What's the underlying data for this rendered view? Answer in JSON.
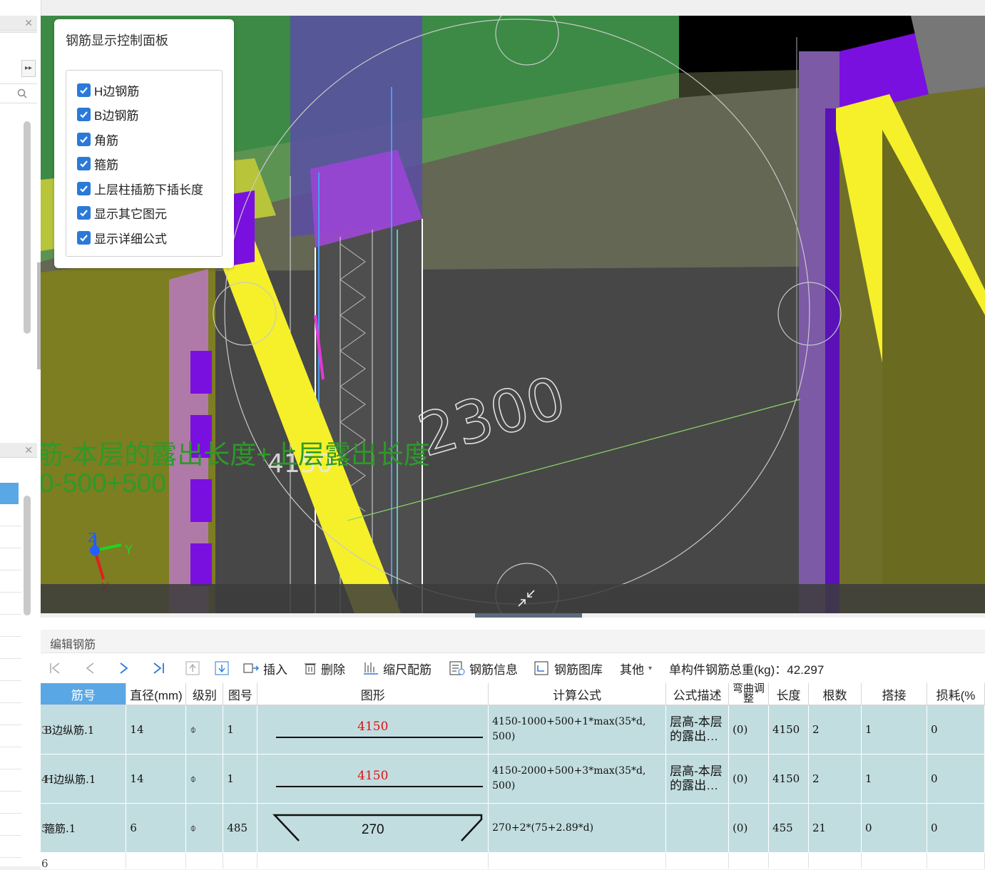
{
  "viewport": {
    "dimension_label": "2300",
    "dimension_label_small": "4150",
    "formula_overlay_line1": "筋-本层的露出长度+上层露出长度",
    "formula_overlay_line2": "0-500+500",
    "axis": {
      "z": "Z",
      "y": "Y",
      "x": "X"
    }
  },
  "rebar_display_panel": {
    "title": "钢筋显示控制面板",
    "options": [
      {
        "label": "H边钢筋",
        "checked": true
      },
      {
        "label": "B边钢筋",
        "checked": true
      },
      {
        "label": "角筋",
        "checked": true
      },
      {
        "label": "箍筋",
        "checked": true
      },
      {
        "label": "上层柱插筋下插长度",
        "checked": true
      },
      {
        "label": "显示其它图元",
        "checked": true
      },
      {
        "label": "显示详细公式",
        "checked": true
      }
    ]
  },
  "edit_panel": {
    "title": "编辑钢筋",
    "toolbar": {
      "insert": "插入",
      "delete": "删除",
      "scale_rebar": "缩尺配筋",
      "rebar_info": "钢筋信息",
      "rebar_library": "钢筋图库",
      "other": "其他",
      "total_weight": "单构件钢筋总重(kg)：42.297"
    },
    "columns": [
      "筋号",
      "直径(mm)",
      "级别",
      "图号",
      "图形",
      "计算公式",
      "公式描述",
      "弯曲调整",
      "长度",
      "根数",
      "搭接",
      "损耗(%"
    ],
    "rows": [
      {
        "num": "3",
        "name": "B边纵筋.1",
        "diameter": "14",
        "grade": "⌽",
        "fig": "1",
        "shape_value": "4150",
        "formula_line1": "4150-1000+500+1*max(35*d,",
        "formula_line2": "500)",
        "desc_line1": "层高-本层",
        "desc_line2": "的露出…",
        "bend": "(0)",
        "length": "4150",
        "count": "2",
        "lap": "1",
        "loss": "0"
      },
      {
        "num": "4",
        "name": "H边纵筋.1",
        "diameter": "14",
        "grade": "⌽",
        "fig": "1",
        "shape_value": "4150",
        "formula_line1": "4150-2000+500+3*max(35*d,",
        "formula_line2": "500)",
        "desc_line1": "层高-本层",
        "desc_line2": "的露出…",
        "bend": "(0)",
        "length": "4150",
        "count": "2",
        "lap": "1",
        "loss": "0"
      },
      {
        "num": "5",
        "name": "箍筋.1",
        "diameter": "6",
        "grade": "⌽",
        "fig": "485",
        "shape_value": "270",
        "formula_line1": "270+2*(75+2.89*d)",
        "formula_line2": "",
        "desc_line1": "",
        "desc_line2": "",
        "bend": "(0)",
        "length": "455",
        "count": "21",
        "lap": "0",
        "loss": "0"
      }
    ],
    "next_row_num": "6"
  },
  "colors": {
    "accent_blue": "#2a7ad8",
    "row_bg": "#c2dde0",
    "header_selected": "#5aa7e6",
    "model_green": "#3c8a45",
    "model_yellow": "#f5f02a",
    "model_purple": "#7a10e0"
  }
}
